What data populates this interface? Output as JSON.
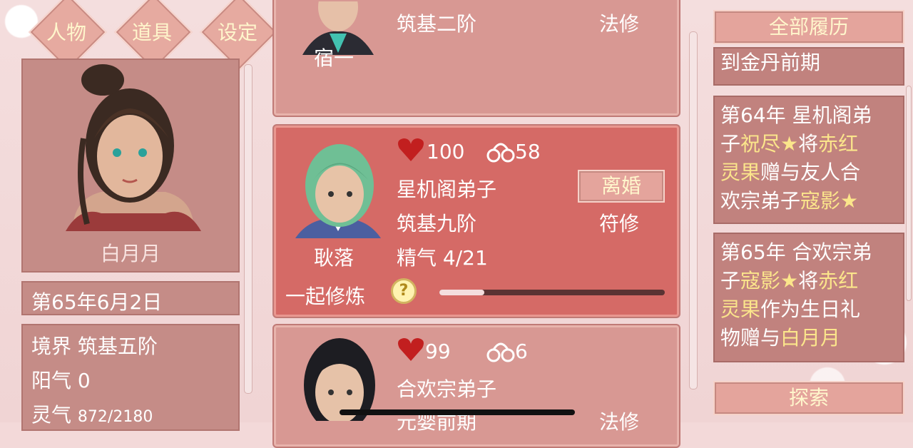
{
  "nav": {
    "people": "人物",
    "items": "道具",
    "settings": "设定"
  },
  "player": {
    "name": "白月月",
    "date": "第65年6月2日",
    "stats": [
      {
        "label": "境界",
        "value": "筑基五阶"
      },
      {
        "label": "阳气",
        "value": "0"
      },
      {
        "label": "灵气",
        "value": "872/2180"
      }
    ]
  },
  "cards": [
    {
      "name": "宿一",
      "realm": "筑基二阶",
      "type": "法修"
    },
    {
      "name": "耿落",
      "hp": "100",
      "bond": "58",
      "sect": "星机阁弟子",
      "realm": "筑基九阶",
      "type": "符修",
      "essence": "精气 4/21",
      "divorce": "离婚",
      "cultivate": "一起修炼",
      "help": "?",
      "progress": 0.2
    },
    {
      "name": "",
      "hp": "99",
      "bond": "6",
      "sect": "合欢宗弟子",
      "realm": "元婴前期",
      "type": "法修"
    }
  ],
  "history": {
    "title": "全部履历",
    "explore": "探索",
    "partial": "到金丹前期",
    "entries": [
      {
        "p1": "第64年 星机阁弟",
        "p2": "子",
        "h1": "祝尽★",
        "p3": "将",
        "h2": "赤红",
        "p4": "灵果",
        "p5": "赠与友人合",
        "p6": "欢宗弟子",
        "h3": "寇影★"
      },
      {
        "p1": "第65年 合欢宗弟",
        "p2": "子",
        "h1": "寇影★",
        "p3": "将",
        "h2": "赤红",
        "p4": "灵果",
        "p5": "作为生日礼",
        "p6": "物赠与",
        "h3": "白月月"
      }
    ]
  },
  "colors": {
    "gold": "#fbe58b",
    "card": "#d89893",
    "selected": "#d56a66",
    "heart": "#c21f1f"
  }
}
